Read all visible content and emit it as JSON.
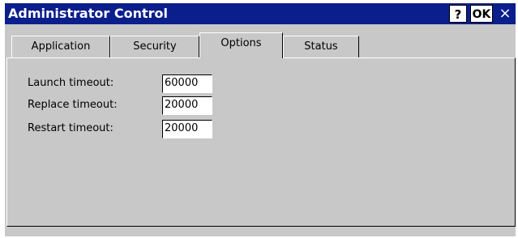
{
  "window": {
    "title": "Administrator Control",
    "help_label": "?",
    "ok_label": "OK",
    "close_label": "×"
  },
  "tabs": [
    {
      "label": "Application"
    },
    {
      "label": "Security"
    },
    {
      "label": "Options",
      "selected": true
    },
    {
      "label": "Status"
    }
  ],
  "options": {
    "launch_label": "Launch timeout:",
    "launch_value": "60000",
    "replace_label": "Replace timeout:",
    "replace_value": "20000",
    "restart_label": "Restart timeout:",
    "restart_value": "20000"
  },
  "colors": {
    "titlebar": "#0a1e8c",
    "panel": "#c8c8c8"
  }
}
